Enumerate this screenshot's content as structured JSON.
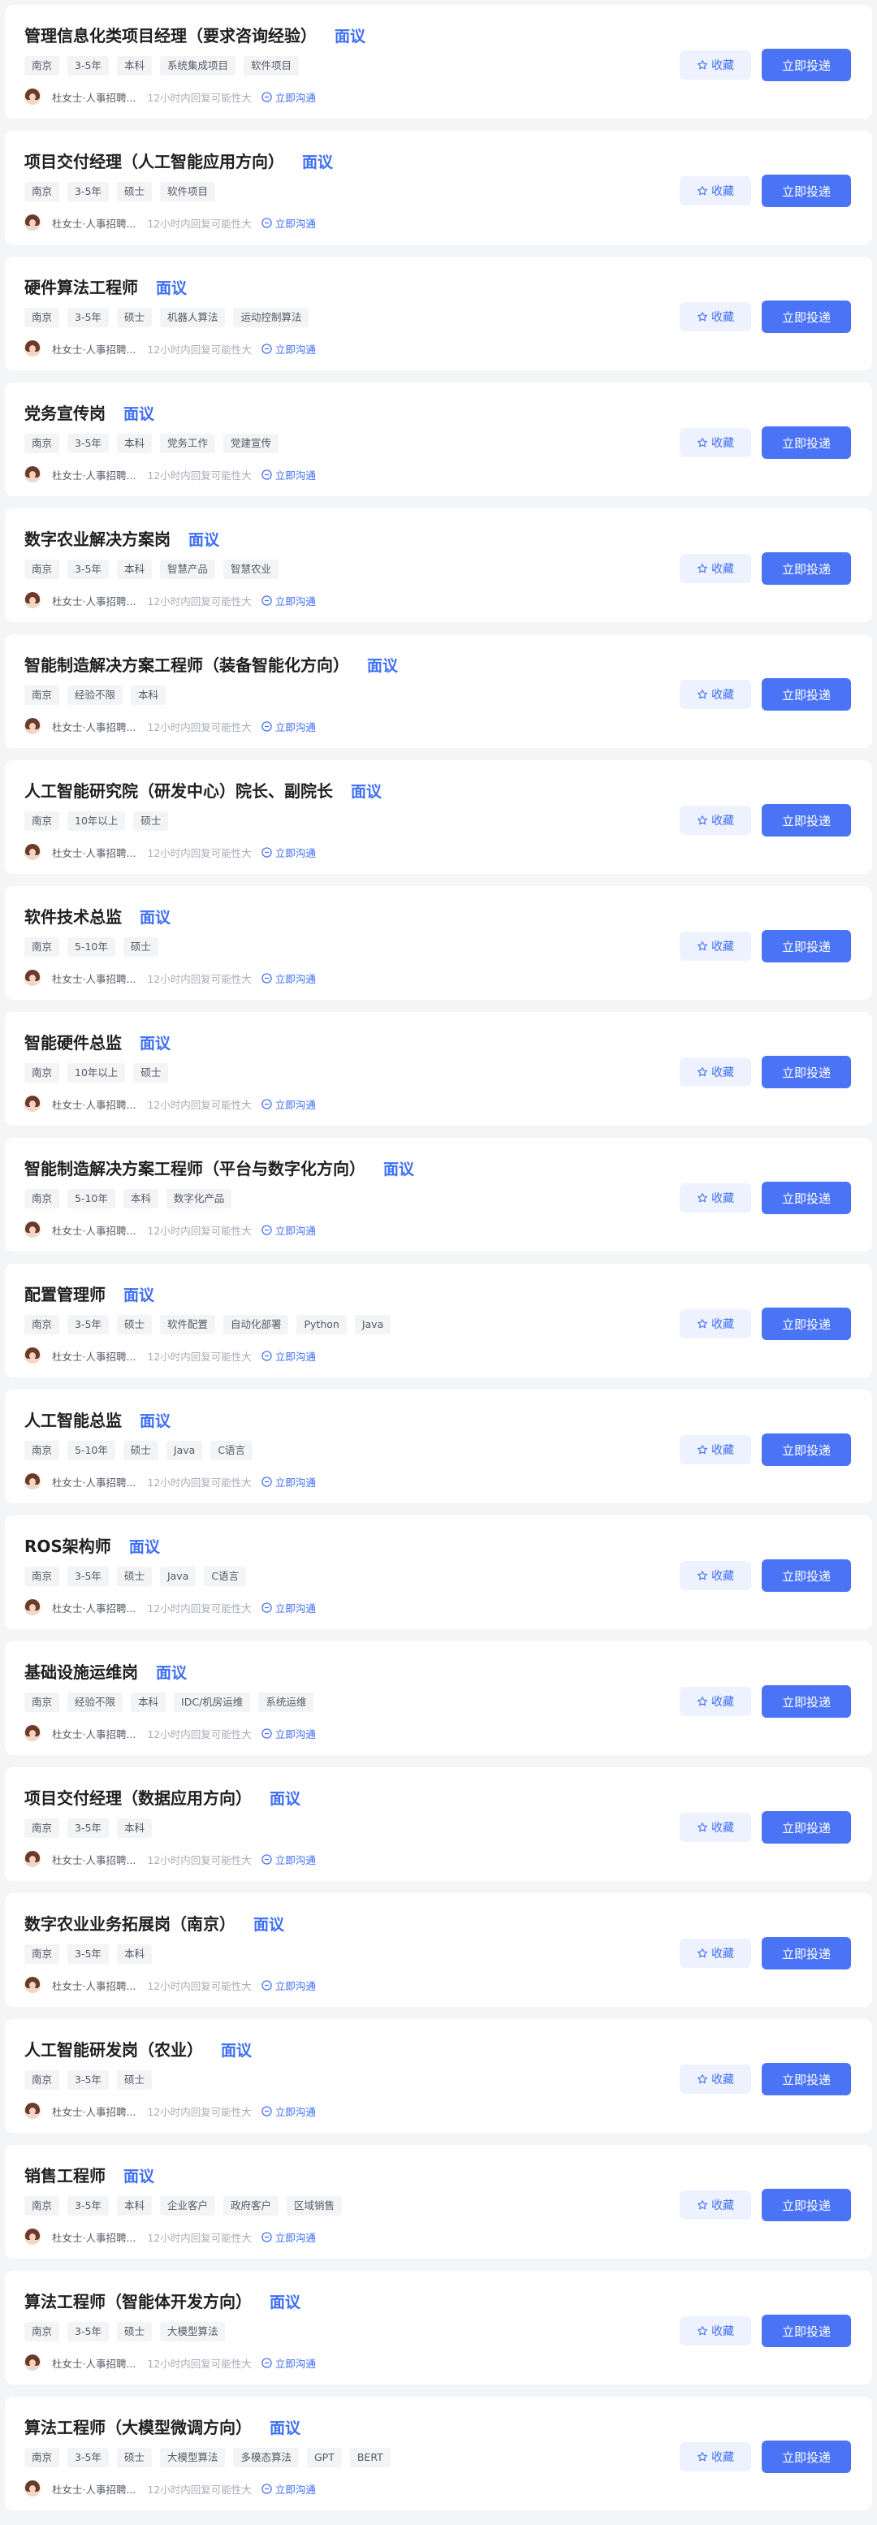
{
  "common": {
    "recruiter_name": "杜女士·人事招聘...",
    "reply_hint": "12小时内回复可能性大",
    "chat_label": "立即沟通",
    "favorite_label": "收藏",
    "apply_label": "立即投递",
    "accent_color": "#3d6ef5",
    "apply_button_color": "#4a74f5"
  },
  "jobs": [
    {
      "title": "管理信息化类项目经理（要求咨询经验）",
      "salary": "面议",
      "tags": [
        "南京",
        "3-5年",
        "本科",
        "系统集成项目",
        "软件项目"
      ]
    },
    {
      "title": "项目交付经理（人工智能应用方向）",
      "salary": "面议",
      "tags": [
        "南京",
        "3-5年",
        "硕士",
        "软件项目"
      ]
    },
    {
      "title": "硬件算法工程师",
      "salary": "面议",
      "tags": [
        "南京",
        "3-5年",
        "硕士",
        "机器人算法",
        "运动控制算法"
      ]
    },
    {
      "title": "党务宣传岗",
      "salary": "面议",
      "tags": [
        "南京",
        "3-5年",
        "本科",
        "党务工作",
        "党建宣传"
      ]
    },
    {
      "title": "数字农业解决方案岗",
      "salary": "面议",
      "tags": [
        "南京",
        "3-5年",
        "本科",
        "智慧产品",
        "智慧农业"
      ]
    },
    {
      "title": "智能制造解决方案工程师（装备智能化方向）",
      "salary": "面议",
      "tags": [
        "南京",
        "经验不限",
        "本科"
      ]
    },
    {
      "title": "人工智能研究院（研发中心）院长、副院长",
      "salary": "面议",
      "tags": [
        "南京",
        "10年以上",
        "硕士"
      ]
    },
    {
      "title": "软件技术总监",
      "salary": "面议",
      "tags": [
        "南京",
        "5-10年",
        "硕士"
      ]
    },
    {
      "title": "智能硬件总监",
      "salary": "面议",
      "tags": [
        "南京",
        "10年以上",
        "硕士"
      ]
    },
    {
      "title": "智能制造解决方案工程师（平台与数字化方向）",
      "salary": "面议",
      "tags": [
        "南京",
        "5-10年",
        "本科",
        "数字化产品"
      ]
    },
    {
      "title": "配置管理师",
      "salary": "面议",
      "tags": [
        "南京",
        "3-5年",
        "硕士",
        "软件配置",
        "自动化部署",
        "Python",
        "Java"
      ]
    },
    {
      "title": "人工智能总监",
      "salary": "面议",
      "tags": [
        "南京",
        "5-10年",
        "硕士",
        "Java",
        "C语言"
      ]
    },
    {
      "title": "ROS架构师",
      "salary": "面议",
      "tags": [
        "南京",
        "3-5年",
        "硕士",
        "Java",
        "C语言"
      ]
    },
    {
      "title": "基础设施运维岗",
      "salary": "面议",
      "tags": [
        "南京",
        "经验不限",
        "本科",
        "IDC/机房运维",
        "系统运维"
      ]
    },
    {
      "title": "项目交付经理（数据应用方向）",
      "salary": "面议",
      "tags": [
        "南京",
        "3-5年",
        "本科"
      ]
    },
    {
      "title": "数字农业业务拓展岗（南京）",
      "salary": "面议",
      "tags": [
        "南京",
        "3-5年",
        "本科"
      ]
    },
    {
      "title": "人工智能研发岗（农业）",
      "salary": "面议",
      "tags": [
        "南京",
        "3-5年",
        "硕士"
      ]
    },
    {
      "title": "销售工程师",
      "salary": "面议",
      "tags": [
        "南京",
        "3-5年",
        "本科",
        "企业客户",
        "政府客户",
        "区域销售"
      ]
    },
    {
      "title": "算法工程师（智能体开发方向）",
      "salary": "面议",
      "tags": [
        "南京",
        "3-5年",
        "硕士",
        "大模型算法"
      ]
    },
    {
      "title": "算法工程师（大模型微调方向）",
      "salary": "面议",
      "tags": [
        "南京",
        "3-5年",
        "硕士",
        "大模型算法",
        "多模态算法",
        "GPT",
        "BERT"
      ]
    }
  ]
}
